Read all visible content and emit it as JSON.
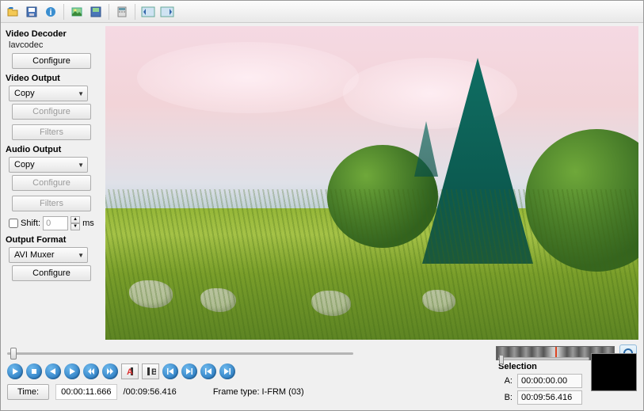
{
  "toolbar": {
    "icons": [
      "open",
      "save",
      "info",
      "image-open",
      "image-save",
      "calculator",
      "film-first",
      "film-last"
    ]
  },
  "sidebar": {
    "videoDecoder": {
      "title": "Video Decoder",
      "value": "lavcodec",
      "configure": "Configure"
    },
    "videoOutput": {
      "title": "Video Output",
      "selected": "Copy",
      "configure": "Configure",
      "filters": "Filters"
    },
    "audioOutput": {
      "title": "Audio Output",
      "selected": "Copy",
      "configure": "Configure",
      "filters": "Filters",
      "shiftLabel": "Shift:",
      "shiftValue": "0",
      "shiftUnit": "ms"
    },
    "outputFormat": {
      "title": "Output Format",
      "selected": "AVI Muxer",
      "configure": "Configure"
    }
  },
  "playback": {
    "sliderPercent": 2
  },
  "selection": {
    "title": "Selection",
    "aLabel": "A:",
    "a": "00:00:00.00",
    "bLabel": "B:",
    "b": "00:09:56.416"
  },
  "status": {
    "timeLabel": "Time:",
    "current": "00:00:11.666",
    "total": "/00:09:56.416",
    "frameType": "Frame type: I-FRM (03)"
  }
}
